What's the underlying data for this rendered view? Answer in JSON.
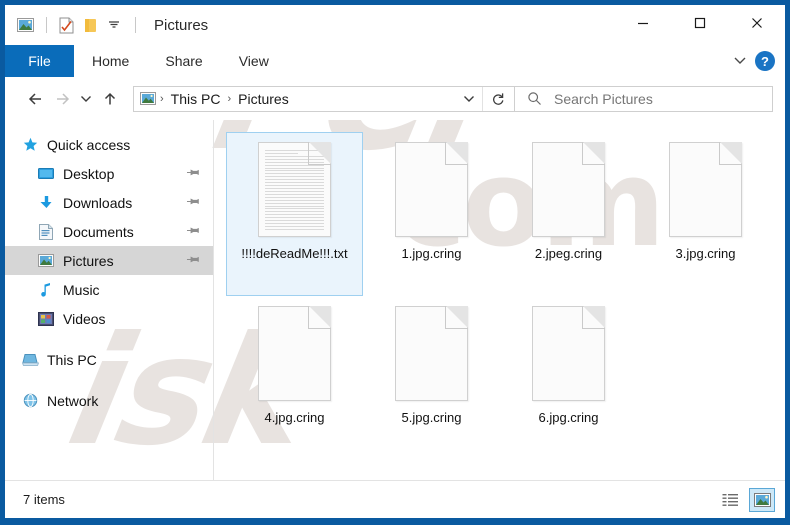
{
  "window": {
    "title": "Pictures",
    "frame_color": "#0a5aa0",
    "accent_color": "#0a6cba"
  },
  "quick_access_toolbar": {
    "items": [
      {
        "name": "pictures-folder-icon",
        "label": "Pictures"
      },
      {
        "name": "properties-icon",
        "label": "Properties"
      },
      {
        "name": "new-folder-icon",
        "label": "New folder"
      },
      {
        "name": "customize-chevron-icon",
        "label": "Customize Quick Access Toolbar"
      }
    ]
  },
  "window_controls": {
    "minimize": "—",
    "maximize": "☐",
    "close": "✕"
  },
  "ribbon": {
    "tabs": [
      {
        "label": "File",
        "selected": true
      },
      {
        "label": "Home",
        "selected": false
      },
      {
        "label": "Share",
        "selected": false
      },
      {
        "label": "View",
        "selected": false
      }
    ],
    "expand_label": "⌄",
    "help_label": "?"
  },
  "navigation": {
    "back": "←",
    "forward": "→",
    "recent": "⌄",
    "up": "↑",
    "refresh": "↻",
    "dropdown": "⌄"
  },
  "breadcrumb": {
    "icon": "pictures-icon",
    "separator": "›",
    "crumbs": [
      "This PC",
      "Pictures"
    ]
  },
  "search": {
    "placeholder": "Search Pictures",
    "value": "",
    "icon": "search-icon"
  },
  "sidebar": {
    "items": [
      {
        "label": "Quick access",
        "icon": "star-icon",
        "indent": false,
        "pinned": false,
        "selected": false
      },
      {
        "label": "Desktop",
        "icon": "desktop-icon",
        "indent": true,
        "pinned": true,
        "selected": false
      },
      {
        "label": "Downloads",
        "icon": "download-icon",
        "indent": true,
        "pinned": true,
        "selected": false
      },
      {
        "label": "Documents",
        "icon": "documents-icon",
        "indent": true,
        "pinned": true,
        "selected": false
      },
      {
        "label": "Pictures",
        "icon": "pictures-icon",
        "indent": true,
        "pinned": true,
        "selected": true
      },
      {
        "label": "Music",
        "icon": "music-icon",
        "indent": true,
        "pinned": false,
        "selected": false
      },
      {
        "label": "Videos",
        "icon": "videos-icon",
        "indent": true,
        "pinned": false,
        "selected": false
      },
      {
        "label": "This PC",
        "icon": "thispc-icon",
        "indent": false,
        "pinned": false,
        "selected": false
      },
      {
        "label": "Network",
        "icon": "network-icon",
        "indent": false,
        "pinned": false,
        "selected": false
      }
    ],
    "pin_glyph": "✒"
  },
  "files": [
    {
      "name": "!!!!deReadMe!!!.txt",
      "icon": "text-document-icon",
      "selected": true,
      "lined": true
    },
    {
      "name": "1.jpg.cring",
      "icon": "blank-document-icon",
      "selected": false,
      "lined": false
    },
    {
      "name": "2.jpeg.cring",
      "icon": "blank-document-icon",
      "selected": false,
      "lined": false
    },
    {
      "name": "3.jpg.cring",
      "icon": "blank-document-icon",
      "selected": false,
      "lined": false
    },
    {
      "name": "4.jpg.cring",
      "icon": "blank-document-icon",
      "selected": false,
      "lined": false
    },
    {
      "name": "5.jpg.cring",
      "icon": "blank-document-icon",
      "selected": false,
      "lined": false
    },
    {
      "name": "6.jpg.cring",
      "icon": "blank-document-icon",
      "selected": false,
      "lined": false
    }
  ],
  "statusbar": {
    "item_count": "7 items",
    "views": [
      {
        "name": "details-view-button",
        "active": false
      },
      {
        "name": "large-icons-view-button",
        "active": true
      }
    ]
  },
  "watermark": {
    "line1": "PCr",
    "line2": "isk",
    "line3": "com"
  }
}
